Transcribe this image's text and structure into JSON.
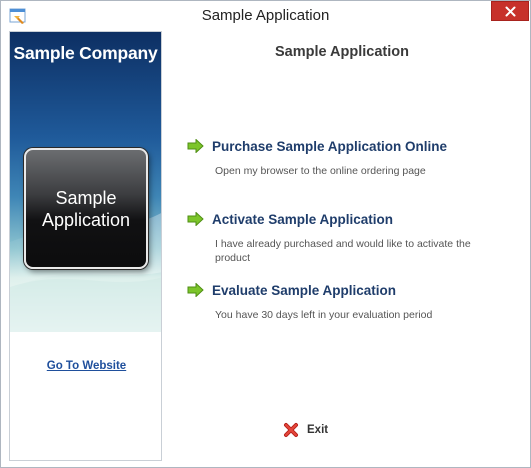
{
  "window": {
    "title": "Sample Application",
    "close_icon": "close-icon"
  },
  "sidebar": {
    "company_name": "Sample Company",
    "product_name": "Sample\nApplication",
    "website_link": "Go To Website"
  },
  "main": {
    "title": "Sample Application",
    "options": [
      {
        "title": "Purchase Sample Application Online",
        "description": "Open my browser to the online ordering page",
        "icon": "green-arrow-icon"
      },
      {
        "title": "Activate Sample Application",
        "description": "I have already purchased and would like to activate the product",
        "icon": "green-arrow-icon"
      },
      {
        "title": "Evaluate Sample Application",
        "description": "You have 30 days left in your evaluation period",
        "icon": "green-arrow-icon"
      }
    ],
    "exit_label": "Exit",
    "exit_icon": "red-x-icon"
  },
  "colors": {
    "option_title": "#1f3d6b",
    "link": "#1f4f9c",
    "arrow_green": "#7cc52a",
    "close_red": "#c7312b"
  }
}
